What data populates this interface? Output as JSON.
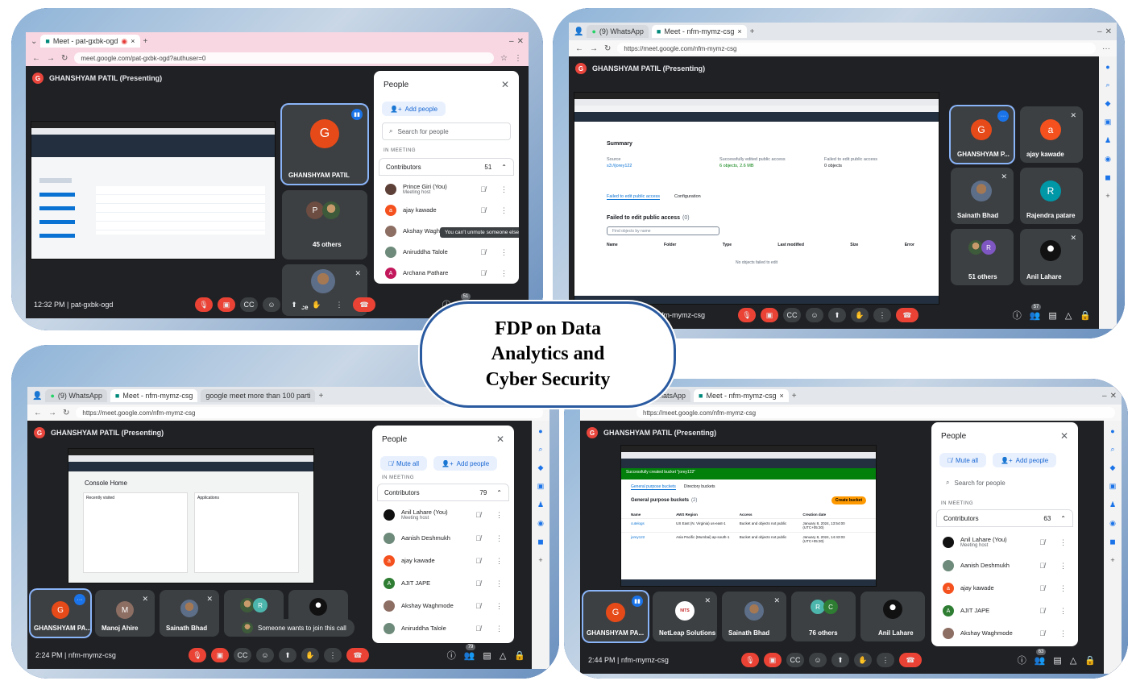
{
  "center_title": [
    "FDP on Data",
    "Analytics and",
    "Cyber Security"
  ],
  "q1": {
    "tab_title": "Meet - pat-gxbk-ogd",
    "url": "meet.google.com/pat-gxbk-ogd?authuser=0",
    "presenting": "GHANSHYAM PATIL (Presenting)",
    "presenter_initial": "G",
    "tiles": [
      {
        "name": "GHANSHYAM PATIL",
        "initial": "G"
      },
      {
        "name": "45 others",
        "initial": "P"
      },
      {
        "name": "Prince Giri"
      }
    ],
    "time_code": "12:32 PM  |  pat-gxbk-ogd",
    "participant_count": "51",
    "panel": {
      "title": "People",
      "add_people": "Add people",
      "search": "Search for people",
      "in_meeting": "IN MEETING",
      "contributors": "Contributors",
      "count": "51",
      "tooltip": "You can't unmute someone else",
      "people": [
        {
          "name": "Prince Giri (You)",
          "sub": "Meeting host",
          "color": "#5d4037"
        },
        {
          "name": "ajay kawade",
          "initial": "a",
          "color": "#f4511e"
        },
        {
          "name": "Akshay Waghmode",
          "color": "#8d6e63"
        },
        {
          "name": "Aniruddha Talole",
          "color": "#6d8a7a"
        },
        {
          "name": "Archana Pathare",
          "initial": "A",
          "color": "#c2185b"
        }
      ]
    }
  },
  "q2": {
    "tab1": "(9) WhatsApp",
    "tab2": "Meet - nfm-mymz-csg",
    "url": "https://meet.google.com/nfm-mymz-csg",
    "presenting": "GHANSHYAM PATIL (Presenting)",
    "aws": {
      "summary": "Summary",
      "source_label": "Source",
      "source_value": "s3://jorey122",
      "success_label": "Successfully edited public access",
      "success_value": "6 objects, 2.6 MB",
      "failed_label": "Failed to edit public access",
      "failed_value": "0 objects",
      "tab_failed": "Failed to edit public access",
      "tab_config": "Configuration",
      "failed_heading": "Failed to edit public access",
      "failed_count": "(0)",
      "find_placeholder": "Find objects by name",
      "cols": [
        "Name",
        "Folder",
        "Type",
        "Last modified",
        "Size",
        "Error"
      ],
      "empty": "No objects failed to edit"
    },
    "tiles": [
      {
        "name": "GHANSHYAM P...",
        "initial": "G"
      },
      {
        "name": "ajay kawade",
        "initial": "a"
      },
      {
        "name": "Sainath Bhad"
      },
      {
        "name": "Rajendra patare",
        "initial": "R"
      },
      {
        "name": "51 others",
        "initial": "R"
      },
      {
        "name": "Anil Lahare"
      }
    ],
    "code": "nfm-mymz-csg",
    "participant_count": "57"
  },
  "q3": {
    "tab1": "(9) WhatsApp",
    "tab2": "Meet - nfm-mymz-csg",
    "tab3": "google meet more than 100 parti",
    "url": "https://meet.google.com/nfm-mymz-csg",
    "presenting": "GHANSHYAM PATIL (Presenting)",
    "console_home": "Console Home",
    "recently_visited": "Recently visited",
    "applications": "Applications",
    "tiles": [
      {
        "name": "GHANSHYAM PA...",
        "initial": "G"
      },
      {
        "name": "Manoj Ahire",
        "initial": "M"
      },
      {
        "name": "Sainath Bhad"
      },
      {
        "name": "",
        "initial": "R"
      },
      {
        "name": ""
      }
    ],
    "toast": "Someone wants to join this call",
    "time_code": "2:24 PM  |  nfm-mymz-csg",
    "participant_count": "79",
    "panel": {
      "title": "People",
      "mute_all": "Mute all",
      "add_people": "Add people",
      "in_meeting": "IN MEETING",
      "contributors": "Contributors",
      "count": "79",
      "people": [
        {
          "name": "Anil Lahare (You)",
          "sub": "Meeting host",
          "color": "#111"
        },
        {
          "name": "Aanish Deshmukh",
          "color": "#6d8a7a"
        },
        {
          "name": "ajay kawade",
          "initial": "a",
          "color": "#f4511e"
        },
        {
          "name": "AJIT JAPE",
          "initial": "A",
          "color": "#2e7d32"
        },
        {
          "name": "Akshay Waghmode",
          "color": "#8d6e63"
        },
        {
          "name": "Aniruddha Talole",
          "color": "#6d8a7a"
        }
      ]
    }
  },
  "q4": {
    "tab1": "(9) WhatsApp",
    "tab2": "Meet - nfm-mymz-csg",
    "url": "https://meet.google.com/nfm-mymz-csg",
    "presenting": "GHANSHYAM PATIL (Presenting)",
    "s3": {
      "banner": "Successfully created bucket \"jorey122\"",
      "tab_general": "General purpose buckets",
      "tab_directory": "Directory buckets",
      "heading": "General purpose buckets",
      "count": "(2)",
      "create": "Create bucket",
      "cols": [
        "Name",
        "AWS Region",
        "Access",
        "Creation date"
      ],
      "rows": [
        {
          "name": "cutelogs",
          "region": "US East (N. Virginia) us-east-1",
          "access": "Bucket and objects not public",
          "date": "January 8, 2024, 13:54:00 (UTC+05:30)"
        },
        {
          "name": "jorey122",
          "region": "Asia Pacific (Mumbai) ap-south-1",
          "access": "Bucket and objects not public",
          "date": "January 8, 2024, 14:43:03 (UTC+05:30)"
        }
      ]
    },
    "tiles": [
      {
        "name": "GHANSHYAM PA...",
        "initial": "G"
      },
      {
        "name": "NetLeap Solutions"
      },
      {
        "name": "Sainath Bhad"
      },
      {
        "name": "76 others",
        "initial": "R"
      },
      {
        "name": "Anil Lahare"
      }
    ],
    "time_code": "2:44 PM  |  nfm-mymz-csg",
    "participant_count": "63",
    "panel": {
      "title": "People",
      "mute_all": "Mute all",
      "add_people": "Add people",
      "search": "Search for people",
      "in_meeting": "IN MEETING",
      "contributors": "Contributors",
      "count": "63",
      "people": [
        {
          "name": "Anil Lahare (You)",
          "sub": "Meeting host",
          "color": "#111"
        },
        {
          "name": "Aanish Deshmukh",
          "color": "#6d8a7a"
        },
        {
          "name": "ajay kawade",
          "initial": "a",
          "color": "#f4511e"
        },
        {
          "name": "AJIT JAPE",
          "initial": "A",
          "color": "#2e7d32"
        },
        {
          "name": "Akshay Waghmode",
          "color": "#8d6e63"
        }
      ]
    }
  },
  "colors": {
    "frame": "#3b6fb6",
    "meet_bg": "#202124",
    "tile": "#3c4043",
    "end_call": "#ea4335",
    "accent": "#8ab4f8"
  }
}
